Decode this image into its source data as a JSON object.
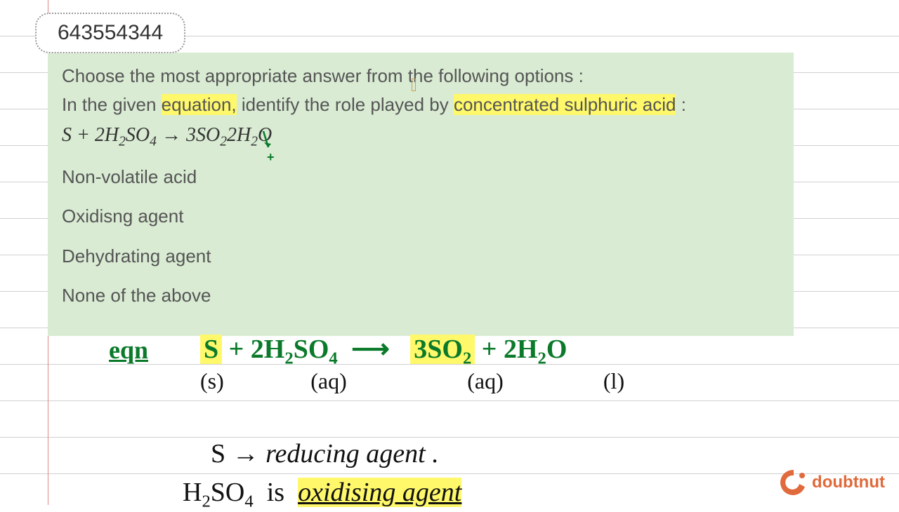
{
  "id_number": "643554344",
  "question": {
    "line1": "Choose the most appropriate answer from the following options :",
    "line2_pre": "In the given ",
    "line2_hl1": "equation,",
    "line2_mid": " identify the role played by ",
    "line2_hl2": "concentrated sulphuric acid",
    "line2_post": " :",
    "equation_display": "S + 2H₂SO₄ → 3SO₂2H₂O"
  },
  "options": {
    "a": "Non-volatile acid",
    "b": "Oxidisng agent",
    "c": "Dehydrating agent",
    "d": "None of the above"
  },
  "handwriting": {
    "eqn_label": "eqn",
    "reactant_s": "S",
    "plus1": " + ",
    "reactant_h2so4": "2H₂SO₄",
    "arrow": " ⟶ ",
    "product_so2": "3SO₂",
    "plus2": " + ",
    "product_h2o": "2H₂O",
    "state_s": "(s)",
    "state_aq1": "(aq)",
    "state_aq2": "(aq)",
    "state_l": "(l)",
    "line3_s": "S",
    "line3_arrow": " → ",
    "line3_text": "reducing agent .",
    "line4_pre": "H₂SO₄  is  ",
    "line4_hl": "oxidising agent"
  },
  "logo_text": "doubtnut"
}
